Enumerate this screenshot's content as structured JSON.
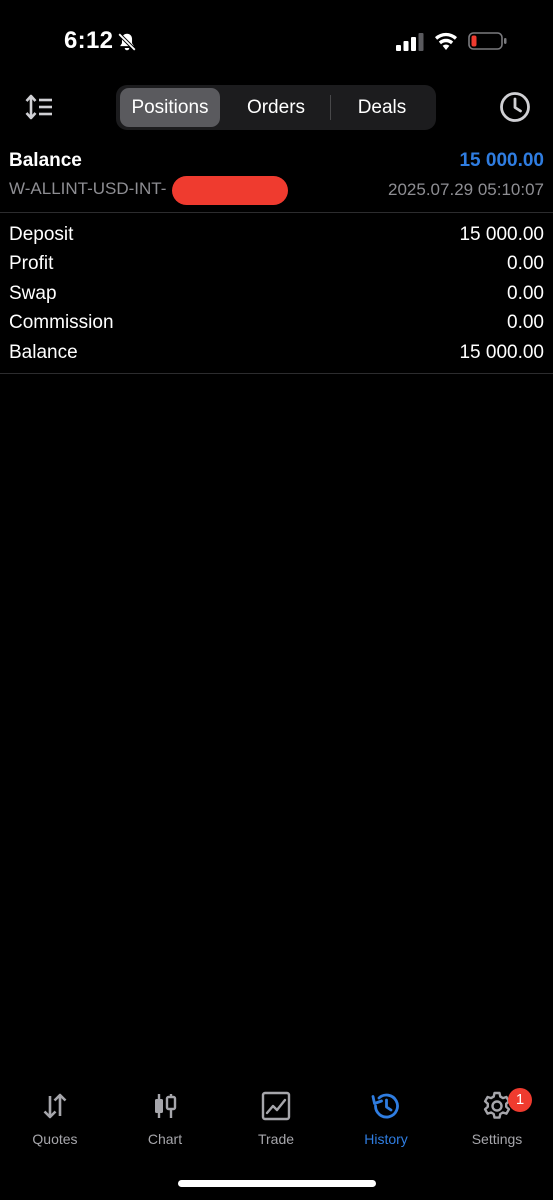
{
  "status_bar": {
    "time": "6:12",
    "icons": [
      "mute-bell-icon",
      "cellular-signal-icon",
      "wifi-icon",
      "battery-low-icon"
    ]
  },
  "toolbar": {
    "sort_icon": "sort-arrows-icon",
    "tabs": [
      {
        "label": "Positions",
        "active": true
      },
      {
        "label": "Orders",
        "active": false
      },
      {
        "label": "Deals",
        "active": false
      }
    ],
    "history_icon": "clock-icon"
  },
  "balance_header": {
    "title": "Balance",
    "amount": "15 000.00",
    "account": "W-ALLINT-USD-INT-",
    "datetime": "2025.07.29 05:10:07"
  },
  "details": [
    {
      "label": "Deposit",
      "value": "15 000.00"
    },
    {
      "label": "Profit",
      "value": "0.00"
    },
    {
      "label": "Swap",
      "value": "0.00"
    },
    {
      "label": "Commission",
      "value": "0.00"
    },
    {
      "label": "Balance",
      "value": "15 000.00"
    }
  ],
  "tab_bar": {
    "items": [
      {
        "label": "Quotes",
        "icon": "quotes-arrows-icon",
        "active": false
      },
      {
        "label": "Chart",
        "icon": "candlestick-icon",
        "active": false
      },
      {
        "label": "Trade",
        "icon": "trade-chart-icon",
        "active": false
      },
      {
        "label": "History",
        "icon": "history-icon",
        "active": true
      },
      {
        "label": "Settings",
        "icon": "gear-icon",
        "active": false,
        "badge": "1"
      }
    ]
  },
  "colors": {
    "background": "#000000",
    "accent": "#2f7de1",
    "muted_text": "#8e8e93",
    "badge": "#ef3b2f",
    "segment_bg": "#1c1c1e",
    "segment_active": "#5a5a5e"
  }
}
